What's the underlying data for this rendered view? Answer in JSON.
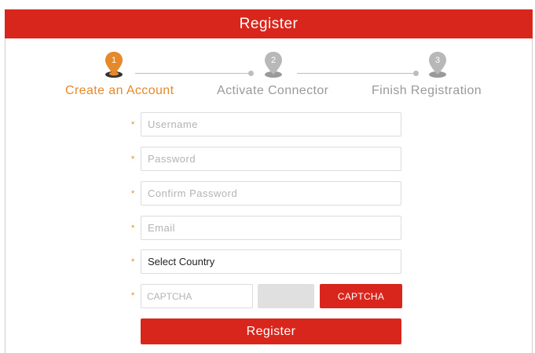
{
  "header": {
    "title": "Register"
  },
  "steps": [
    {
      "number": "1",
      "label": "Create an Account",
      "state": "active"
    },
    {
      "number": "2",
      "label": "Activate Connector",
      "state": "inactive"
    },
    {
      "number": "3",
      "label": "Finish Registration",
      "state": "inactive"
    }
  ],
  "form": {
    "required_marker": "*",
    "username": {
      "placeholder": "Username",
      "value": ""
    },
    "password": {
      "placeholder": "Password",
      "value": ""
    },
    "confirm_password": {
      "placeholder": "Confirm Password",
      "value": ""
    },
    "email": {
      "placeholder": "Email",
      "value": ""
    },
    "country": {
      "selected": "Select Country"
    },
    "captcha": {
      "placeholder": "CAPTCHA",
      "button_label": "CAPTCHA"
    },
    "submit_label": "Register"
  },
  "colors": {
    "brand_red": "#d9261c",
    "active_orange": "#e5892a",
    "inactive_gray": "#9a9a9a"
  },
  "icons": {
    "step_marker": "map-pin-icon"
  }
}
